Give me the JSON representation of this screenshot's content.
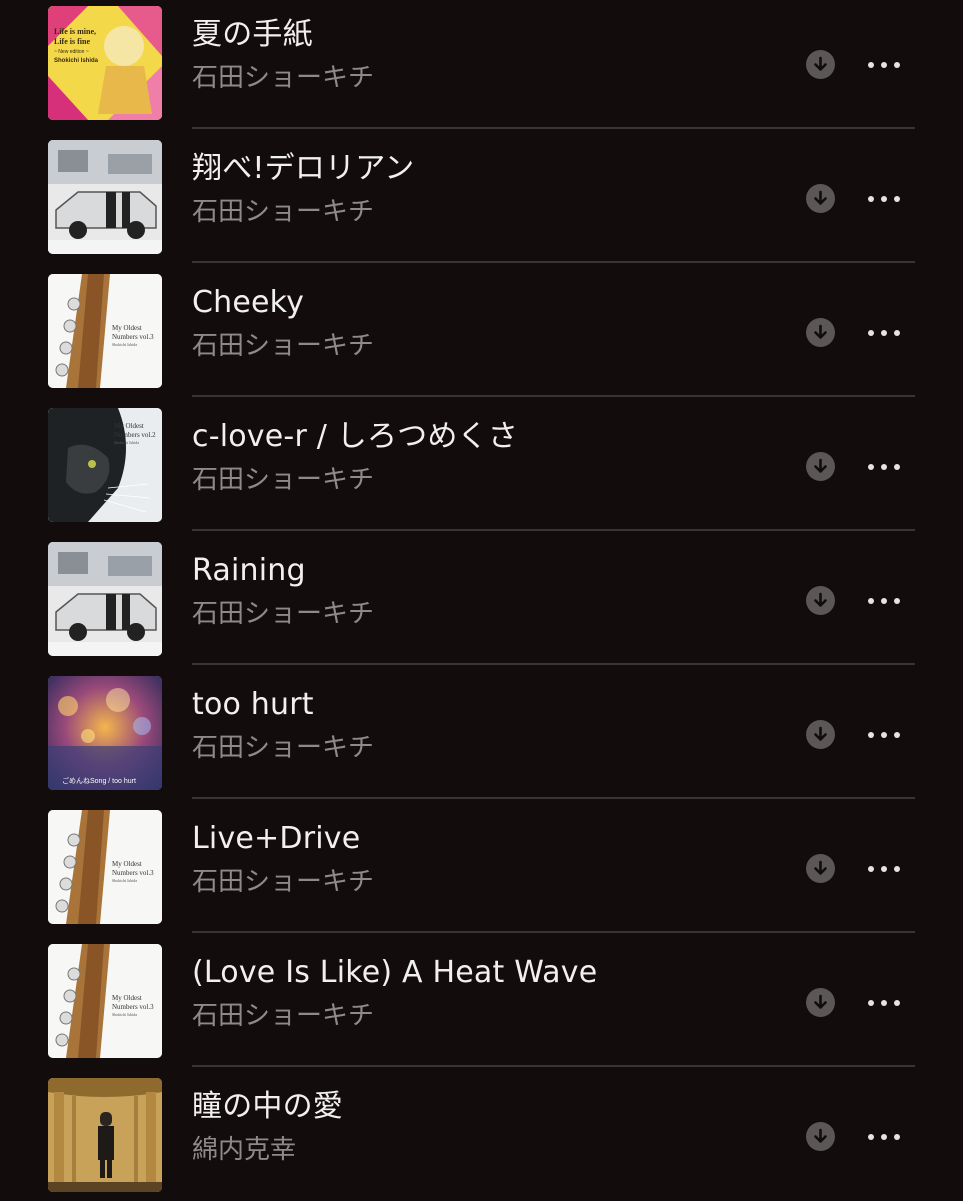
{
  "tracks": [
    {
      "title": "夏の手紙",
      "artist": "石田ショーキチ",
      "art": "album-life-is-mine",
      "art_text": [
        "Life is mine,",
        "Life is fine",
        "~ New edition ~",
        "Shokichi Ishida"
      ]
    },
    {
      "title": "翔べ!デロリアン",
      "artist": "石田ショーキチ",
      "art": "album-delorean"
    },
    {
      "title": "Cheeky",
      "artist": "石田ショーキチ",
      "art": "album-my-oldest-numbers-vol3",
      "art_text": [
        "My Oldest",
        "Numbers vol.3",
        "Shokichi Ishida"
      ]
    },
    {
      "title": "c-love-r / しろつめくさ",
      "artist": "石田ショーキチ",
      "art": "album-my-oldest-numbers-vol2",
      "art_text": [
        "My Oldest",
        "Numbers vol.2",
        "Shokichi Ishida"
      ]
    },
    {
      "title": "Raining",
      "artist": "石田ショーキチ",
      "art": "album-delorean"
    },
    {
      "title": "too hurt",
      "artist": "石田ショーキチ",
      "art": "album-too-hurt",
      "art_text": [
        "ごめんねSong / too hurt"
      ]
    },
    {
      "title": "Live+Drive",
      "artist": "石田ショーキチ",
      "art": "album-my-oldest-numbers-vol3",
      "art_text": [
        "My Oldest",
        "Numbers vol.3",
        "Shokichi Ishida"
      ]
    },
    {
      "title": "(Love Is Like) A Heat Wave",
      "artist": "石田ショーキチ",
      "art": "album-my-oldest-numbers-vol3",
      "art_text": [
        "My Oldest",
        "Numbers vol.3",
        "Shokichi Ishida"
      ]
    },
    {
      "title": "瞳の中の愛",
      "artist": "綿内克幸",
      "art": "album-stage-curtain"
    }
  ],
  "icons": {
    "download": "download-circle-icon",
    "more": "ellipsis-icon"
  },
  "colors": {
    "background": "#120d0c",
    "title": "#f2f0ef",
    "subtitle": "#8e8a89",
    "separator": "#3a3433",
    "download_bg": "#5b5756"
  }
}
